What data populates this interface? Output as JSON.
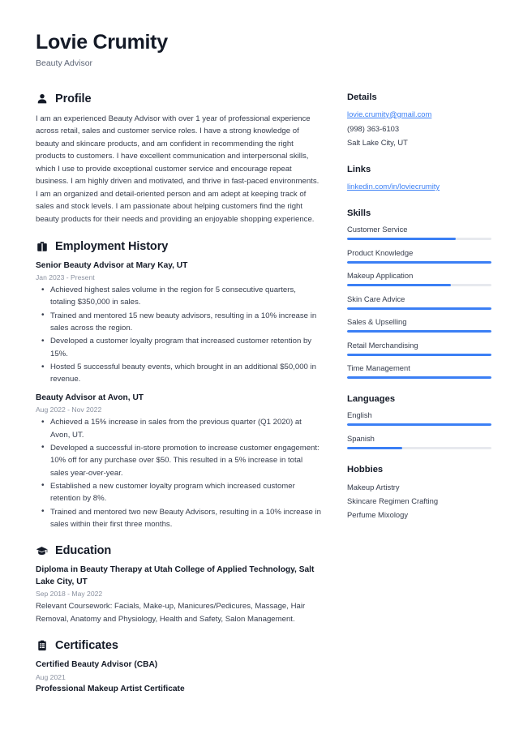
{
  "accent_color": "#3b7ff5",
  "header": {
    "name": "Lovie Crumity",
    "job_title": "Beauty Advisor"
  },
  "main": {
    "profile": {
      "heading": "Profile",
      "icon": "user-icon",
      "text": "I am an experienced Beauty Advisor with over 1 year of professional experience across retail, sales and customer service roles. I have a strong knowledge of beauty and skincare products, and am confident in recommending the right products to customers. I have excellent communication and interpersonal skills, which I use to provide exceptional customer service and encourage repeat business. I am highly driven and motivated, and thrive in fast-paced environments. I am an organized and detail-oriented person and am adept at keeping track of sales and stock levels. I am passionate about helping customers find the right beauty products for their needs and providing an enjoyable shopping experience."
    },
    "employment": {
      "heading": "Employment History",
      "icon": "briefcase-icon",
      "entries": [
        {
          "title": "Senior Beauty Advisor at Mary Kay, UT",
          "date": "Jan 2023 - Present",
          "bullets": [
            "Achieved highest sales volume in the region for 5 consecutive quarters, totaling $350,000 in sales.",
            "Trained and mentored 15 new beauty advisors, resulting in a 10% increase in sales across the region.",
            "Developed a customer loyalty program that increased customer retention by 15%.",
            "Hosted 5 successful beauty events, which brought in an additional $50,000 in revenue."
          ]
        },
        {
          "title": "Beauty Advisor at Avon, UT",
          "date": "Aug 2022 - Nov 2022",
          "bullets": [
            "Achieved a 15% increase in sales from the previous quarter (Q1 2020) at Avon, UT.",
            "Developed a successful in-store promotion to increase customer engagement: 10% off for any purchase over $50. This resulted in a 5% increase in total sales year-over-year.",
            "Established a new customer loyalty program which increased customer retention by 8%.",
            "Trained and mentored two new Beauty Advisors, resulting in a 10% increase in sales within their first three months."
          ]
        }
      ]
    },
    "education": {
      "heading": "Education",
      "icon": "graduation-cap-icon",
      "entries": [
        {
          "title": "Diploma in Beauty Therapy at Utah College of Applied Technology, Salt Lake City, UT",
          "date": "Sep 2018 - May 2022",
          "description": "Relevant Coursework: Facials, Make-up, Manicures/Pedicures, Massage, Hair Removal, Anatomy and Physiology, Health and Safety, Salon Management."
        }
      ]
    },
    "certificates": {
      "heading": "Certificates",
      "icon": "clipboard-icon",
      "entries": [
        {
          "title": "Certified Beauty Advisor (CBA)",
          "date": "Aug 2021"
        },
        {
          "title": "Professional Makeup Artist Certificate",
          "date": ""
        }
      ]
    }
  },
  "sidebar": {
    "details": {
      "heading": "Details",
      "email": "lovie.crumity@gmail.com",
      "phone": "(998) 363-6103",
      "location": "Salt Lake City, UT"
    },
    "links": {
      "heading": "Links",
      "items": [
        {
          "label": "linkedin.com/in/loviecrumity"
        }
      ]
    },
    "skills": {
      "heading": "Skills",
      "items": [
        {
          "label": "Customer Service",
          "level": 75
        },
        {
          "label": "Product Knowledge",
          "level": 100
        },
        {
          "label": "Makeup Application",
          "level": 72
        },
        {
          "label": "Skin Care Advice",
          "level": 100
        },
        {
          "label": "Sales & Upselling",
          "level": 100
        },
        {
          "label": "Retail Merchandising",
          "level": 100
        },
        {
          "label": "Time Management",
          "level": 100
        }
      ]
    },
    "languages": {
      "heading": "Languages",
      "items": [
        {
          "label": "English",
          "level": 100
        },
        {
          "label": "Spanish",
          "level": 38
        }
      ]
    },
    "hobbies": {
      "heading": "Hobbies",
      "items": [
        {
          "label": "Makeup Artistry"
        },
        {
          "label": "Skincare Regimen Crafting"
        },
        {
          "label": "Perfume Mixology"
        }
      ]
    }
  }
}
